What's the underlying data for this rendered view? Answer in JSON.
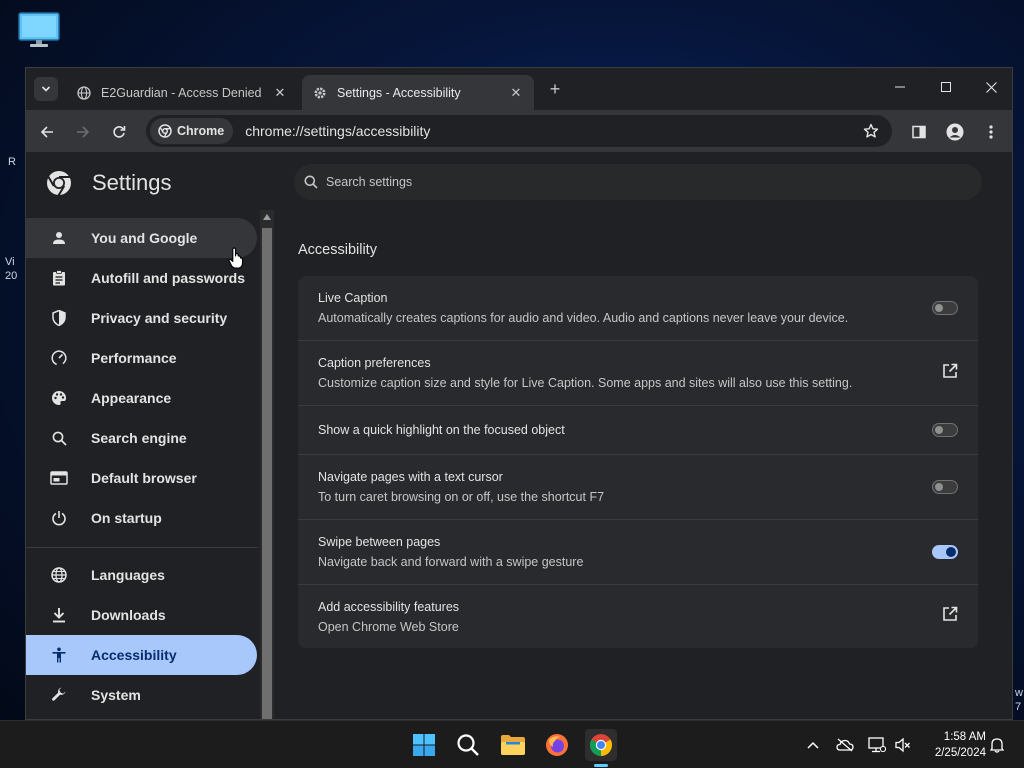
{
  "desktop": {
    "edge_texts": [
      "R",
      "Vi",
      "20",
      "w",
      "7"
    ],
    "icon": "monitor-icon"
  },
  "tabs": [
    {
      "title": "E2Guardian - Access Denied",
      "icon": "globe-icon",
      "active": false
    },
    {
      "title": "Settings - Accessibility",
      "icon": "gear-icon",
      "active": true
    }
  ],
  "toolbar": {
    "chip_label": "Chrome",
    "url": "chrome://settings/accessibility"
  },
  "settings": {
    "title": "Settings",
    "search_placeholder": "Search settings",
    "nav": [
      {
        "label": "You and Google",
        "icon": "person-icon"
      },
      {
        "label": "Autofill and passwords",
        "icon": "clipboard-icon"
      },
      {
        "label": "Privacy and security",
        "icon": "shield-icon"
      },
      {
        "label": "Performance",
        "icon": "speedometer-icon"
      },
      {
        "label": "Appearance",
        "icon": "palette-icon"
      },
      {
        "label": "Search engine",
        "icon": "search-icon"
      },
      {
        "label": "Default browser",
        "icon": "browser-icon"
      },
      {
        "label": "On startup",
        "icon": "power-icon"
      },
      {
        "label": "Languages",
        "icon": "globe-icon"
      },
      {
        "label": "Downloads",
        "icon": "download-icon"
      },
      {
        "label": "Accessibility",
        "icon": "accessibility-icon"
      },
      {
        "label": "System",
        "icon": "wrench-icon"
      }
    ],
    "selected_nav": "Accessibility",
    "section_title": "Accessibility",
    "rows": [
      {
        "label": "Live Caption",
        "sub": "Automatically creates captions for audio and video. Audio and captions never leave your device.",
        "control": "toggle",
        "on": false
      },
      {
        "label": "Caption preferences",
        "sub": "Customize caption size and style for Live Caption. Some apps and sites will also use this setting.",
        "control": "external-link"
      },
      {
        "label": "Show a quick highlight on the focused object",
        "sub": "",
        "control": "toggle",
        "on": false
      },
      {
        "label": "Navigate pages with a text cursor",
        "sub": "To turn caret browsing on or off, use the shortcut F7",
        "control": "toggle",
        "on": false
      },
      {
        "label": "Swipe between pages",
        "sub": "Navigate back and forward with a swipe gesture",
        "control": "toggle",
        "on": true
      },
      {
        "label": "Add accessibility features",
        "sub": "Open Chrome Web Store",
        "control": "external-link"
      }
    ]
  },
  "taskbar": {
    "apps": [
      "windows-start-icon",
      "search-icon",
      "file-explorer-icon",
      "firefox-icon",
      "chrome-icon"
    ],
    "tray": [
      "chevron-up-icon",
      "onedrive-icon",
      "network-icon",
      "volume-muted-icon",
      "notification-bell-icon"
    ],
    "time": "1:58 AM",
    "date": "2/25/2024"
  },
  "colors": {
    "accent": "#a8c7fa",
    "background": "#202124",
    "card": "#292a2d"
  }
}
